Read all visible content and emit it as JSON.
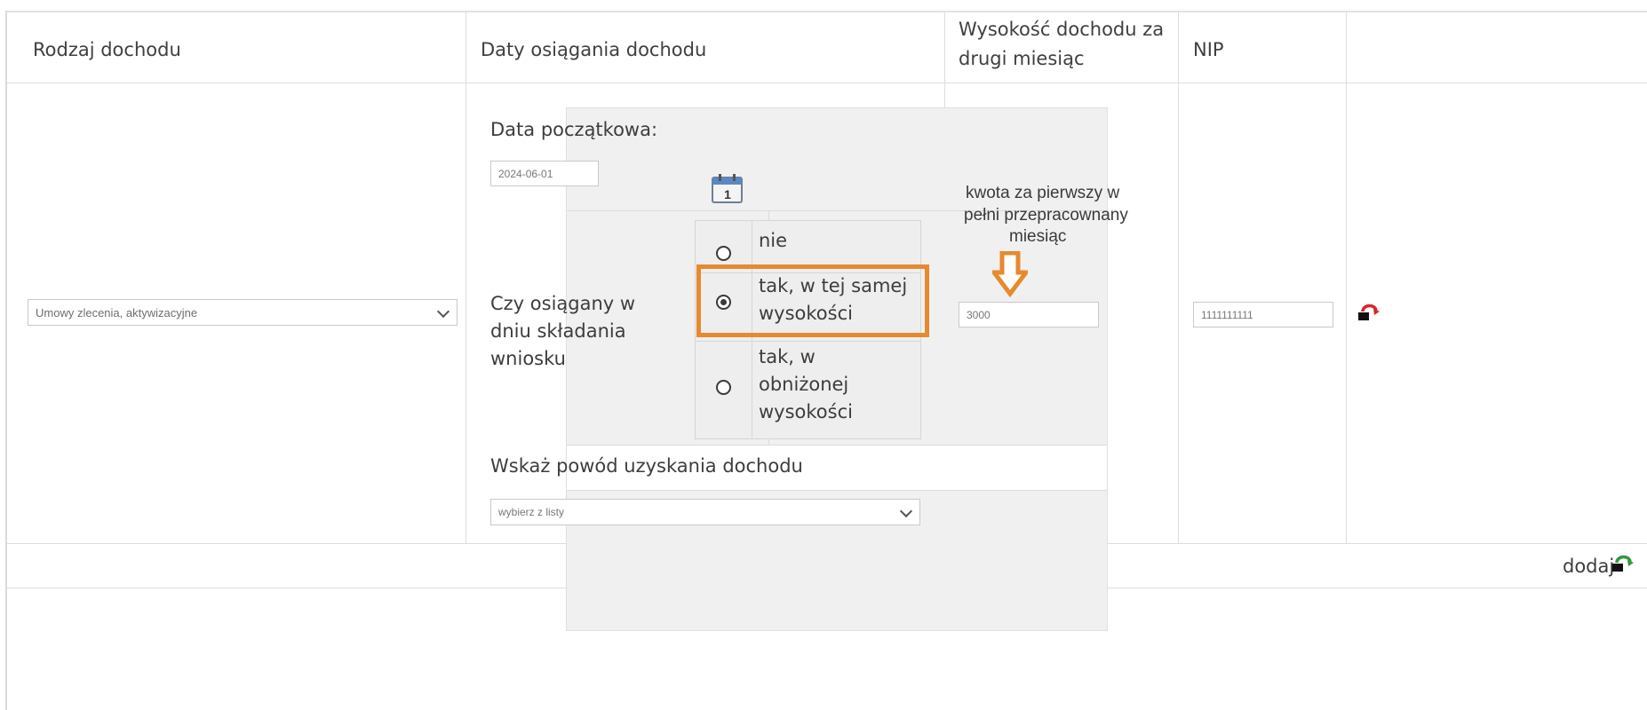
{
  "headers": {
    "col1": "Rodzaj dochodu",
    "col2": "Daty osiągania dochodu",
    "col3_line1": "Wysokość dochodu za",
    "col3_line2": "drugi miesiąc",
    "col4": "NIP"
  },
  "row": {
    "income_type_select": "Umowy zlecenia, aktywizacyjne",
    "start_date_label": "Data początkowa:",
    "start_date_value": "2024-06-01",
    "calendar_day": "1",
    "question_line1": "Czy osiągany w",
    "question_line2": "dniu składania",
    "question_line3": "wniosku",
    "options": [
      {
        "line1": "nie",
        "line2": "",
        "line3": "",
        "selected": false
      },
      {
        "line1": "tak, w tej samej",
        "line2": "wysokości",
        "line3": "",
        "selected": true
      },
      {
        "line1": "tak, w",
        "line2": "obniżonej",
        "line3": "wysokości",
        "selected": false
      }
    ],
    "reason_label": "Wskaż powód uzyskania dochodu",
    "reason_select": "wybierz z listy",
    "amount_value": "3000",
    "nip_value": "1111111111"
  },
  "annotation": {
    "line1": "kwota za pierwszy w",
    "line2": "pełni przepracownany",
    "line3": "miesiąc",
    "color": "#e68a2e"
  },
  "footer": {
    "add_label": "dodaj"
  },
  "colors": {
    "remove_icon": "#d9262c",
    "add_icon": "#2e9b3a",
    "highlight": "#e68a2e"
  }
}
